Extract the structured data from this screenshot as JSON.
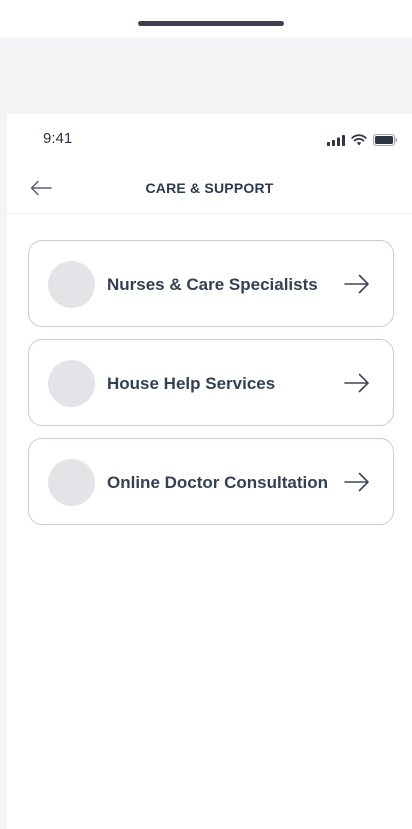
{
  "status_bar": {
    "time": "9:41",
    "icons": [
      "signal-icon",
      "wifi-icon",
      "battery-icon"
    ]
  },
  "header": {
    "title": "CARE & SUPPORT",
    "back_icon": "arrow-left-icon"
  },
  "services": [
    {
      "label": "Nurses & Care Specialists",
      "icon": "arrow-right-icon"
    },
    {
      "label": "House Help Services",
      "icon": "arrow-right-icon"
    },
    {
      "label": "Online Doctor Consultation",
      "icon": "arrow-right-icon"
    }
  ],
  "colors": {
    "text_primary": "#344054",
    "card_border": "#c9ccd2",
    "avatar_placeholder": "#e2e4e7",
    "outer_background": "#f3f4f5"
  }
}
